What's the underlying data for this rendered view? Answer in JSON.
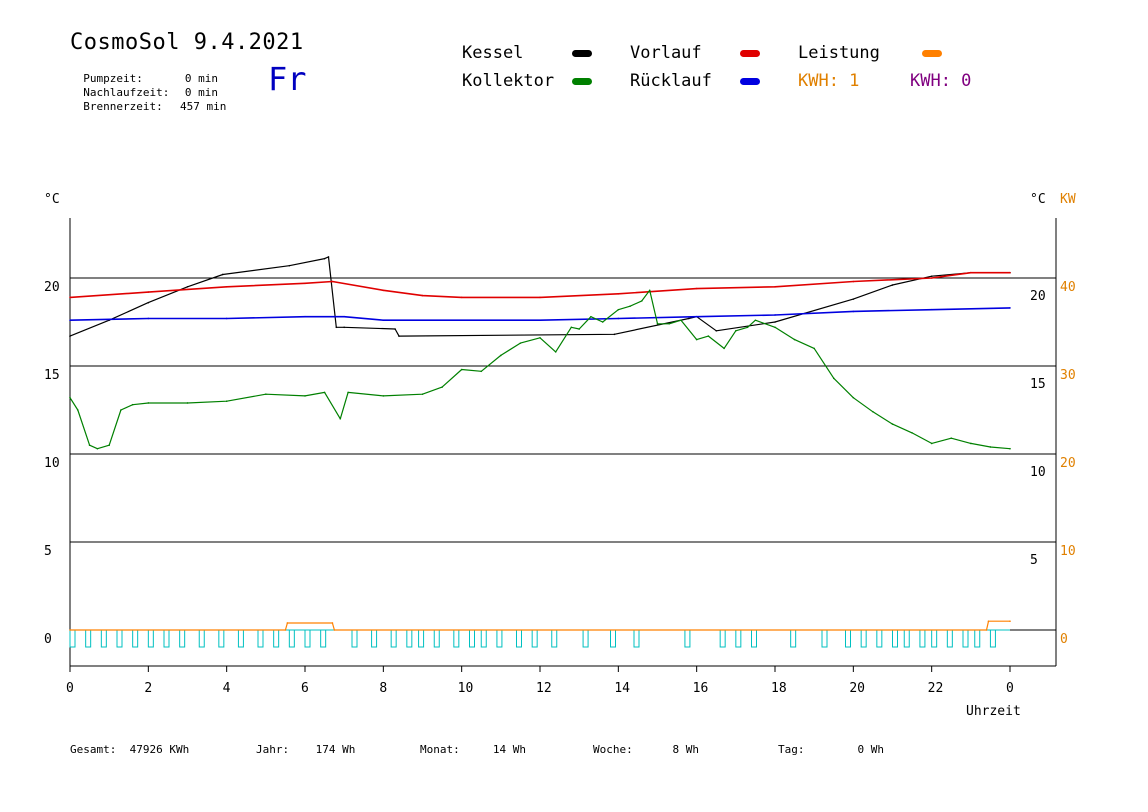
{
  "header": {
    "title": "CosmoSol 9.4.2021",
    "day": "Fr",
    "info": [
      {
        "label": "Pumpzeit:",
        "value": "0 min"
      },
      {
        "label": "Nachlaufzeit:",
        "value": "0 min"
      },
      {
        "label": "Brennerzeit:",
        "value": "457 min"
      }
    ]
  },
  "legend": {
    "kessel": {
      "label": "Kessel",
      "color": "#000000"
    },
    "vorlauf": {
      "label": "Vorlauf",
      "color": "#e00000"
    },
    "leistung": {
      "label": "Leistung",
      "color": "#ff8000"
    },
    "kollektor": {
      "label": "Kollektor",
      "color": "#008000"
    },
    "ruecklauf": {
      "label": "Rücklauf",
      "color": "#0000e0"
    },
    "kwh1": {
      "label": "KWH: 1",
      "color": "#e08000"
    },
    "kwh2": {
      "label": "KWH: 0",
      "color": "#800080"
    }
  },
  "footer": {
    "gesamt": {
      "label": "Gesamt:",
      "value": "47926 KWh"
    },
    "jahr": {
      "label": "Jahr:",
      "value": "174 Wh"
    },
    "monat": {
      "label": "Monat:",
      "value": "14 Wh"
    },
    "woche": {
      "label": "Woche:",
      "value": "8 Wh"
    },
    "tag": {
      "label": "Tag:",
      "value": "0 Wh"
    }
  },
  "chart_data": {
    "type": "line",
    "xlabel": "Uhrzeit",
    "ylabel_left": "°C",
    "ylabel_right": "°C",
    "ylabel_right2": "KW",
    "xlim": [
      0,
      24
    ],
    "ylim": [
      -2,
      24
    ],
    "x_ticks": [
      "0",
      "2",
      "4",
      "6",
      "8",
      "10",
      "12",
      "14",
      "16",
      "18",
      "20",
      "22",
      "0"
    ],
    "y_ticks_left": [
      "0",
      "5",
      "10",
      "15",
      "20"
    ],
    "y_ticks_right": [
      "5",
      "10",
      "15",
      "20"
    ],
    "y_ticks_kw": [
      "0",
      "10",
      "20",
      "30",
      "40"
    ],
    "series": [
      {
        "name": "Kessel",
        "color": "#000000",
        "x": [
          0,
          1,
          2,
          3,
          3.9,
          5.6,
          6.5,
          6.6,
          6.8,
          7,
          8.3,
          8.4,
          13.9,
          15.8,
          16,
          16.5,
          18,
          20,
          21,
          22,
          23,
          24
        ],
        "y": [
          16.7,
          17.6,
          18.6,
          19.5,
          20.2,
          20.7,
          21.1,
          21.2,
          17.2,
          17.2,
          17.1,
          16.7,
          16.8,
          17.7,
          17.8,
          17.0,
          17.5,
          18.8,
          19.6,
          20.1,
          20.3,
          20.3
        ]
      },
      {
        "name": "Vorlauf",
        "color": "#e00000",
        "x": [
          0,
          2,
          4,
          6,
          6.7,
          8,
          9,
          10,
          12,
          14,
          16,
          18,
          20,
          22,
          23,
          24
        ],
        "y": [
          18.9,
          19.2,
          19.5,
          19.7,
          19.8,
          19.3,
          19.0,
          18.9,
          18.9,
          19.1,
          19.4,
          19.5,
          19.8,
          20.0,
          20.3,
          20.3
        ]
      },
      {
        "name": "Rücklauf",
        "color": "#0000e0",
        "x": [
          0,
          2,
          4,
          6,
          7,
          8,
          10,
          12,
          14,
          16,
          18,
          20,
          22,
          24
        ],
        "y": [
          17.6,
          17.7,
          17.7,
          17.8,
          17.8,
          17.6,
          17.6,
          17.6,
          17.7,
          17.8,
          17.9,
          18.1,
          18.2,
          18.3
        ]
      },
      {
        "name": "Kollektor",
        "color": "#008000",
        "x": [
          0,
          0.2,
          0.5,
          0.7,
          1,
          1.3,
          1.6,
          2,
          3,
          4,
          5,
          6,
          6.5,
          6.9,
          7.1,
          8,
          9,
          9.5,
          10,
          10.5,
          11,
          11.5,
          12,
          12.4,
          12.8,
          13,
          13.3,
          13.6,
          14,
          14.3,
          14.6,
          14.8,
          15,
          15.3,
          15.6,
          16,
          16.3,
          16.7,
          17,
          17.3,
          17.5,
          18,
          18.5,
          19,
          19.5,
          20,
          20.5,
          21,
          21.5,
          22,
          22.5,
          23,
          23.5,
          24
        ],
        "y": [
          13.2,
          12.5,
          10.5,
          10.3,
          10.5,
          12.5,
          12.8,
          12.9,
          12.9,
          13.0,
          13.4,
          13.3,
          13.5,
          12.0,
          13.5,
          13.3,
          13.4,
          13.8,
          14.8,
          14.7,
          15.6,
          16.3,
          16.6,
          15.8,
          17.2,
          17.1,
          17.8,
          17.5,
          18.2,
          18.4,
          18.7,
          19.3,
          17.4,
          17.4,
          17.6,
          16.5,
          16.7,
          16.0,
          17.0,
          17.2,
          17.6,
          17.2,
          16.5,
          16.0,
          14.3,
          13.2,
          12.4,
          11.7,
          11.2,
          10.6,
          10.9,
          10.6,
          10.4,
          10.3
        ]
      },
      {
        "name": "Leistung",
        "color": "#ff8000",
        "x": [
          0,
          5.5,
          5.55,
          6.7,
          6.75,
          23.4,
          23.45,
          24
        ],
        "y": [
          0,
          0,
          0.4,
          0.4,
          0,
          0,
          0.5,
          0.5
        ]
      }
    ],
    "pump_pulses_hours": [
      0,
      0.4,
      0.8,
      1.2,
      1.6,
      2,
      2.4,
      2.8,
      3.3,
      3.8,
      4.3,
      4.8,
      5.2,
      5.6,
      6,
      6.4,
      7.2,
      7.7,
      8.2,
      8.6,
      8.9,
      9.3,
      9.8,
      10.2,
      10.5,
      10.9,
      11.4,
      11.8,
      12.3,
      13.1,
      13.8,
      14.4,
      15.7,
      16.6,
      17,
      17.4,
      18.4,
      19.2,
      19.8,
      20.2,
      20.6,
      21,
      21.3,
      21.7,
      22,
      22.4,
      22.8,
      23.1,
      23.5
    ],
    "pump_color": "#00c0c0",
    "grid": true
  }
}
